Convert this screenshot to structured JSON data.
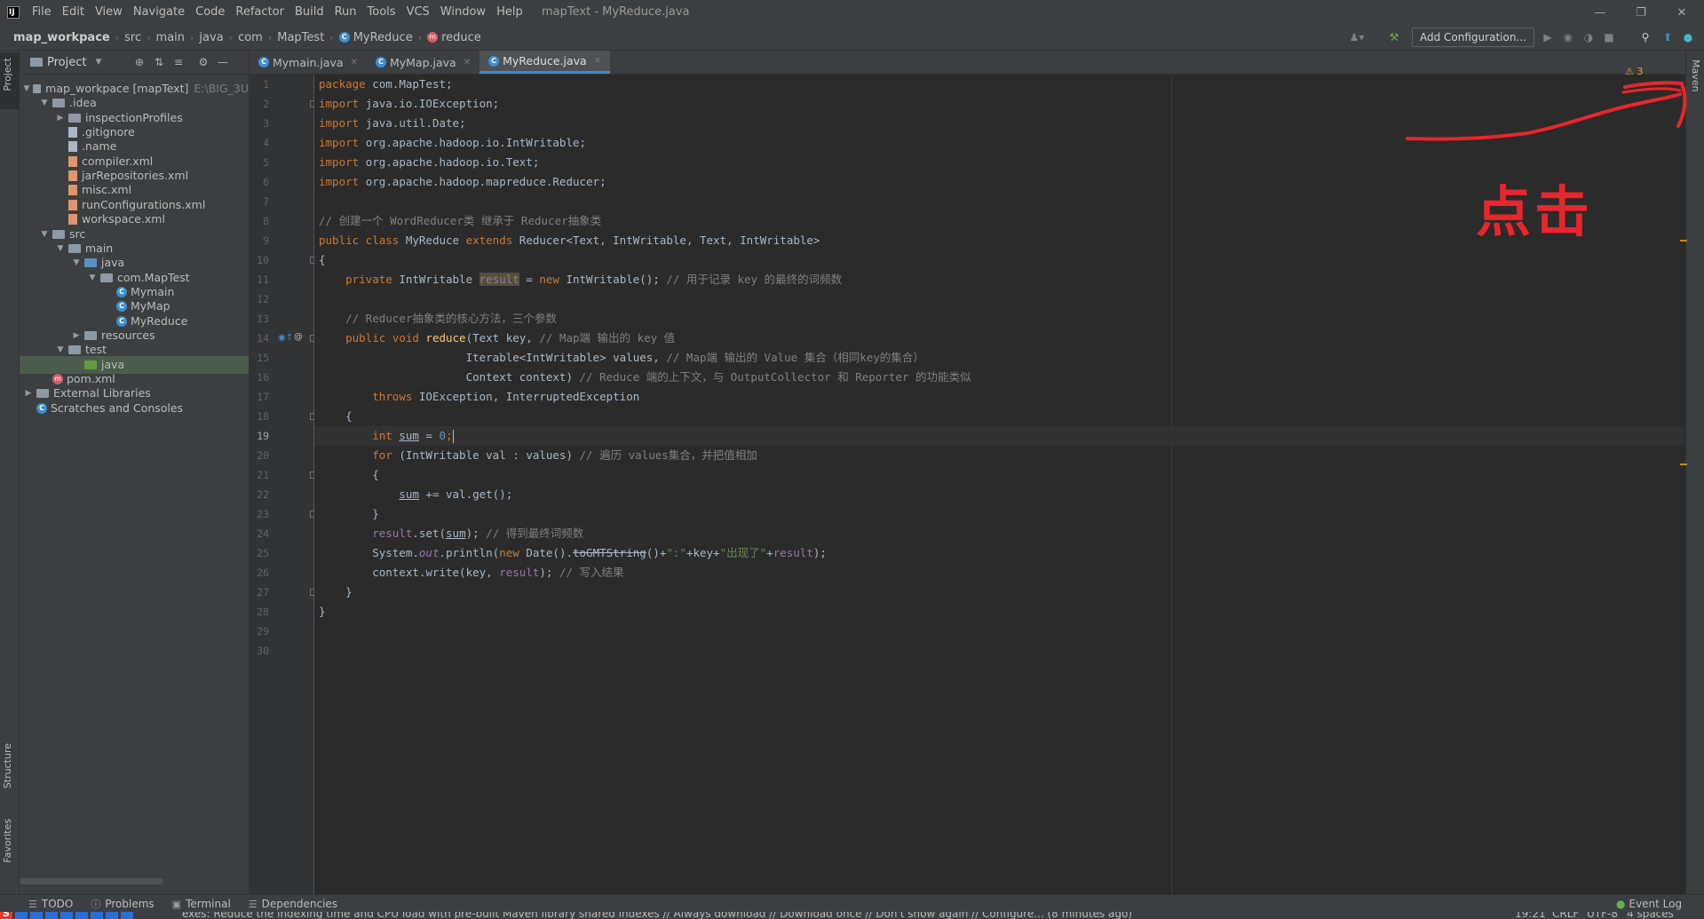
{
  "menu": {
    "items": [
      "File",
      "Edit",
      "View",
      "Navigate",
      "Code",
      "Refactor",
      "Build",
      "Run",
      "Tools",
      "VCS",
      "Window",
      "Help"
    ],
    "window_title": "mapText - MyReduce.java"
  },
  "breadcrumb": {
    "project": "map_workpace",
    "parts": [
      "src",
      "main",
      "java",
      "com",
      "MapTest"
    ],
    "class": "MyReduce",
    "method": "reduce"
  },
  "toolbar": {
    "add_config": "Add Configuration..."
  },
  "side_tabs": {
    "project": "Project",
    "structure": "Structure",
    "favorites": "Favorites",
    "maven": "Maven"
  },
  "project_panel": {
    "title": "Project",
    "tree": [
      {
        "label": "map_workpace [mapText]",
        "extra": "E:\\BIG_3U",
        "depth": 0,
        "twisty": "open",
        "icon": "module"
      },
      {
        "label": ".idea",
        "depth": 1,
        "twisty": "open",
        "icon": "folder"
      },
      {
        "label": "inspectionProfiles",
        "depth": 2,
        "twisty": "closed",
        "icon": "folder"
      },
      {
        "label": ".gitignore",
        "depth": 2,
        "twisty": "",
        "icon": "file"
      },
      {
        "label": ".name",
        "depth": 2,
        "twisty": "",
        "icon": "file"
      },
      {
        "label": "compiler.xml",
        "depth": 2,
        "twisty": "",
        "icon": "xml"
      },
      {
        "label": "jarRepositories.xml",
        "depth": 2,
        "twisty": "",
        "icon": "xml"
      },
      {
        "label": "misc.xml",
        "depth": 2,
        "twisty": "",
        "icon": "xml"
      },
      {
        "label": "runConfigurations.xml",
        "depth": 2,
        "twisty": "",
        "icon": "xml"
      },
      {
        "label": "workspace.xml",
        "depth": 2,
        "twisty": "",
        "icon": "xml"
      },
      {
        "label": "src",
        "depth": 1,
        "twisty": "open",
        "icon": "folder"
      },
      {
        "label": "main",
        "depth": 2,
        "twisty": "open",
        "icon": "folder"
      },
      {
        "label": "java",
        "depth": 3,
        "twisty": "open",
        "icon": "folder-blue"
      },
      {
        "label": "com.MapTest",
        "depth": 4,
        "twisty": "open",
        "icon": "folder"
      },
      {
        "label": "Mymain",
        "depth": 5,
        "twisty": "",
        "icon": "class"
      },
      {
        "label": "MyMap",
        "depth": 5,
        "twisty": "",
        "icon": "class"
      },
      {
        "label": "MyReduce",
        "depth": 5,
        "twisty": "",
        "icon": "class"
      },
      {
        "label": "resources",
        "depth": 3,
        "twisty": "closed",
        "icon": "folder"
      },
      {
        "label": "test",
        "depth": 2,
        "twisty": "open",
        "icon": "folder"
      },
      {
        "label": "java",
        "depth": 3,
        "twisty": "",
        "icon": "folder-green",
        "selected": true
      },
      {
        "label": "pom.xml",
        "depth": 1,
        "twisty": "",
        "icon": "maven"
      },
      {
        "label": "External Libraries",
        "depth": 0,
        "twisty": "closed",
        "icon": "library"
      },
      {
        "label": "Scratches and Consoles",
        "depth": 0,
        "twisty": "",
        "icon": "scratch"
      }
    ]
  },
  "editor": {
    "tabs": [
      {
        "label": "Mymain.java",
        "active": false
      },
      {
        "label": "MyMap.java",
        "active": false
      },
      {
        "label": "MyReduce.java",
        "active": true
      }
    ],
    "current_line": 19,
    "lines": [
      [
        [
          "k",
          "package "
        ],
        [
          "",
          "com.MapTest;"
        ]
      ],
      [
        [
          "k",
          "import "
        ],
        [
          "",
          "java.io.IOException;"
        ]
      ],
      [
        [
          "k",
          "import "
        ],
        [
          "",
          "java.util.Date;"
        ]
      ],
      [
        [
          "k",
          "import "
        ],
        [
          "",
          "org.apache.hadoop.io.IntWritable;"
        ]
      ],
      [
        [
          "k",
          "import "
        ],
        [
          "",
          "org.apache.hadoop.io.Text;"
        ]
      ],
      [
        [
          "k",
          "import "
        ],
        [
          "",
          "org.apache.hadoop.mapreduce.Reducer;"
        ]
      ],
      [],
      [
        [
          "cm",
          "// 创建一个 WordReducer类 继承于 Reducer抽象类"
        ]
      ],
      [
        [
          "k",
          "public class "
        ],
        [
          "",
          "MyReduce "
        ],
        [
          "k",
          "extends "
        ],
        [
          "",
          "Reducer<Text, IntWritable, Text, IntWritable>"
        ]
      ],
      [
        [
          "",
          "{"
        ]
      ],
      [
        [
          "",
          "    "
        ],
        [
          "k",
          "private "
        ],
        [
          "",
          "IntWritable "
        ],
        [
          "f hl",
          "result"
        ],
        [
          "",
          " = "
        ],
        [
          "k",
          "new "
        ],
        [
          "",
          "IntWritable(); "
        ],
        [
          "cm",
          "// 用于记录 key 的最终的词频数"
        ]
      ],
      [],
      [
        [
          "",
          "    "
        ],
        [
          "cm",
          "// Reducer抽象类的核心方法，三个参数"
        ]
      ],
      [
        [
          "",
          "    "
        ],
        [
          "k",
          "public void "
        ],
        [
          "fn",
          "reduce"
        ],
        [
          "",
          "(Text key, "
        ],
        [
          "cm",
          "// Map端 输出的 key 值"
        ]
      ],
      [
        [
          "",
          "                      Iterable<IntWritable> values, "
        ],
        [
          "cm",
          "// Map端 输出的 Value 集合（相同key的集合）"
        ]
      ],
      [
        [
          "",
          "                      Context context) "
        ],
        [
          "cm",
          "// Reduce 端的上下文，与 OutputCollector 和 Reporter 的功能类似"
        ]
      ],
      [
        [
          "",
          "        "
        ],
        [
          "k",
          "throws "
        ],
        [
          "",
          "IOException, InterruptedException"
        ]
      ],
      [
        [
          "",
          "    {"
        ]
      ],
      [
        [
          "",
          "        "
        ],
        [
          "k",
          "int "
        ],
        [
          "ul",
          "sum"
        ],
        [
          "",
          " = "
        ],
        [
          "n",
          "0"
        ],
        [
          "k",
          ";"
        ],
        [
          "caret",
          ""
        ]
      ],
      [
        [
          "",
          "        "
        ],
        [
          "k",
          "for "
        ],
        [
          "",
          "(IntWritable val : values) "
        ],
        [
          "cm",
          "// 遍历 values集合，并把值相加"
        ]
      ],
      [
        [
          "",
          "        {"
        ]
      ],
      [
        [
          "",
          "            "
        ],
        [
          "ul",
          "sum"
        ],
        [
          "",
          " += val.get();"
        ]
      ],
      [
        [
          "",
          "        }"
        ]
      ],
      [
        [
          "",
          "        "
        ],
        [
          "f",
          "result"
        ],
        [
          "",
          ".set("
        ],
        [
          "ul",
          "sum"
        ],
        [
          "",
          "); "
        ],
        [
          "cm",
          "// 得到最终词频数"
        ]
      ],
      [
        [
          "",
          "        System."
        ],
        [
          "st",
          "out"
        ],
        [
          "",
          ".println("
        ],
        [
          "k",
          "new "
        ],
        [
          "",
          "Date()."
        ],
        [
          "strike",
          "toGMTString"
        ],
        [
          "",
          "()+"
        ],
        [
          "s",
          "\":\""
        ],
        [
          "",
          "+key+"
        ],
        [
          "s",
          "\"出现了\""
        ],
        [
          "",
          "+"
        ],
        [
          "f",
          "result"
        ],
        [
          "",
          ");"
        ]
      ],
      [
        [
          "",
          "        context.write(key, "
        ],
        [
          "f",
          "result"
        ],
        [
          "",
          "); "
        ],
        [
          "cm",
          "// 写入结果"
        ]
      ],
      [
        [
          "",
          "    }"
        ]
      ],
      [
        [
          "",
          "}"
        ]
      ],
      [],
      []
    ],
    "warning_badge": "⚠ 3"
  },
  "annotation": {
    "text": "点击",
    "color": "#e8262b"
  },
  "bottom_tools": {
    "todo": "TODO",
    "problems": "Problems",
    "terminal": "Terminal",
    "dependencies": "Dependencies",
    "event_log": "Event Log"
  },
  "status": {
    "message": "exes: Reduce the indexing time and CPU load with pre-built Maven library shared indexes // Always download // Download once // Don't show again // Configure... (8 minutes ago)",
    "position": "19:21",
    "line_sep": "CRLF",
    "encoding": "UTF-8",
    "indent": "4 spaces"
  }
}
